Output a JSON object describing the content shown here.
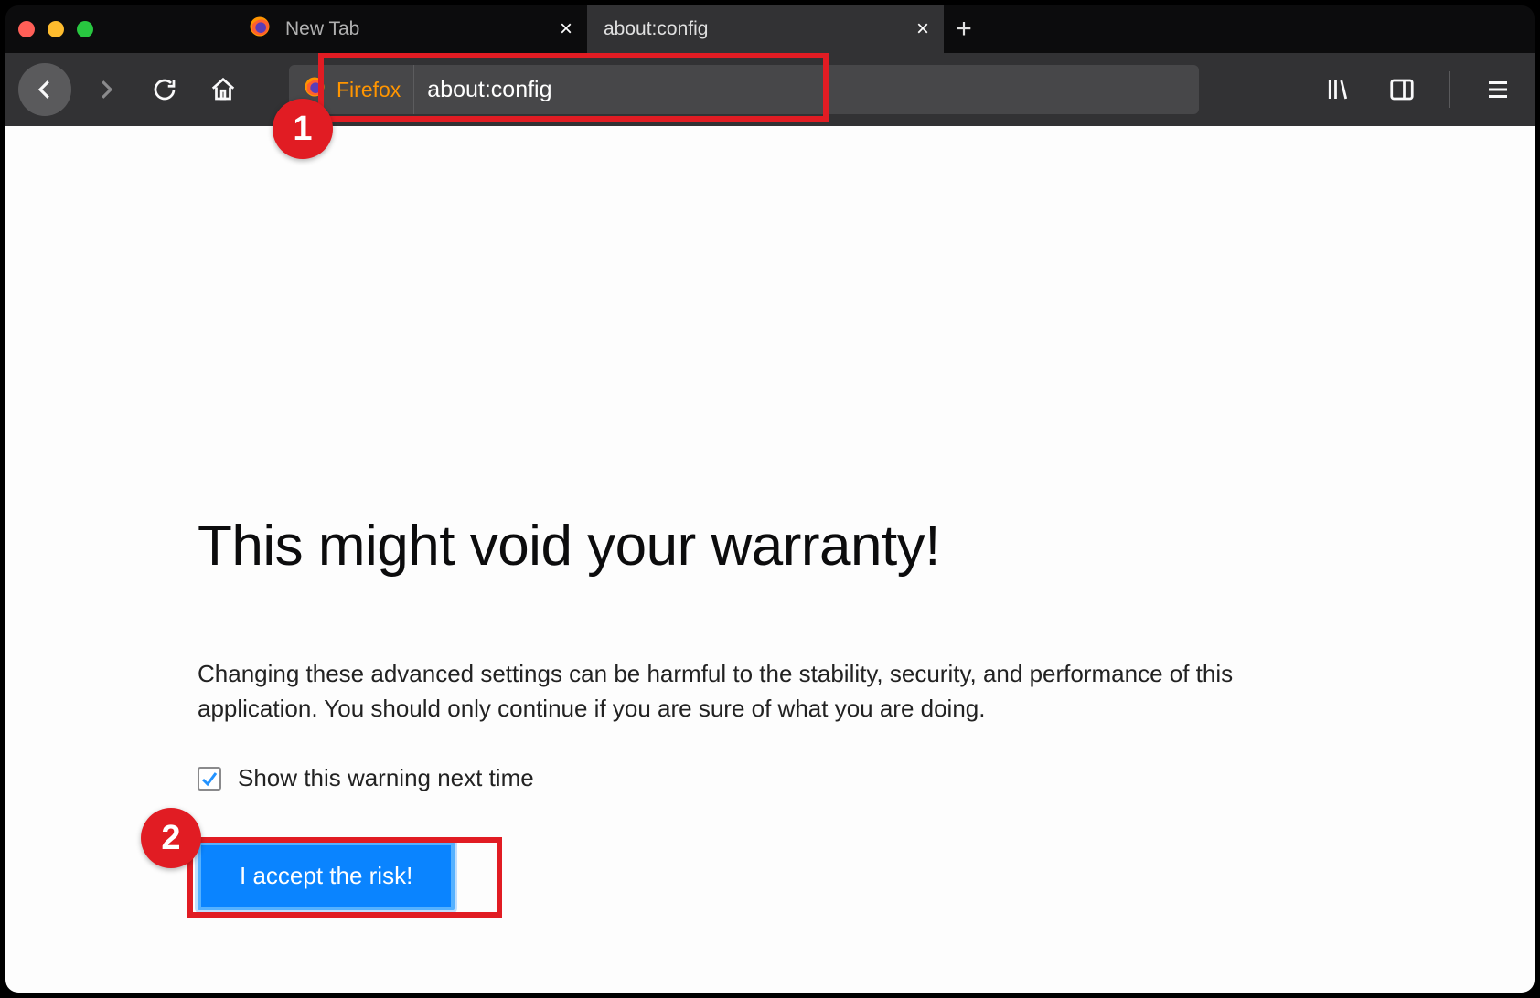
{
  "tabs": [
    {
      "label": "New Tab",
      "active": false
    },
    {
      "label": "about:config",
      "active": true
    }
  ],
  "urlbar": {
    "identity_label": "Firefox",
    "address": "about:config"
  },
  "warning": {
    "title": "This might void your warranty!",
    "body": "Changing these advanced settings can be harmful to the stability, security, and performance of this application. You should only continue if you are sure of what you are doing.",
    "checkbox_label": "Show this warning next time",
    "checkbox_checked": true,
    "accept_label": "I accept the risk!"
  },
  "annotations": {
    "badge1": "1",
    "badge2": "2"
  }
}
